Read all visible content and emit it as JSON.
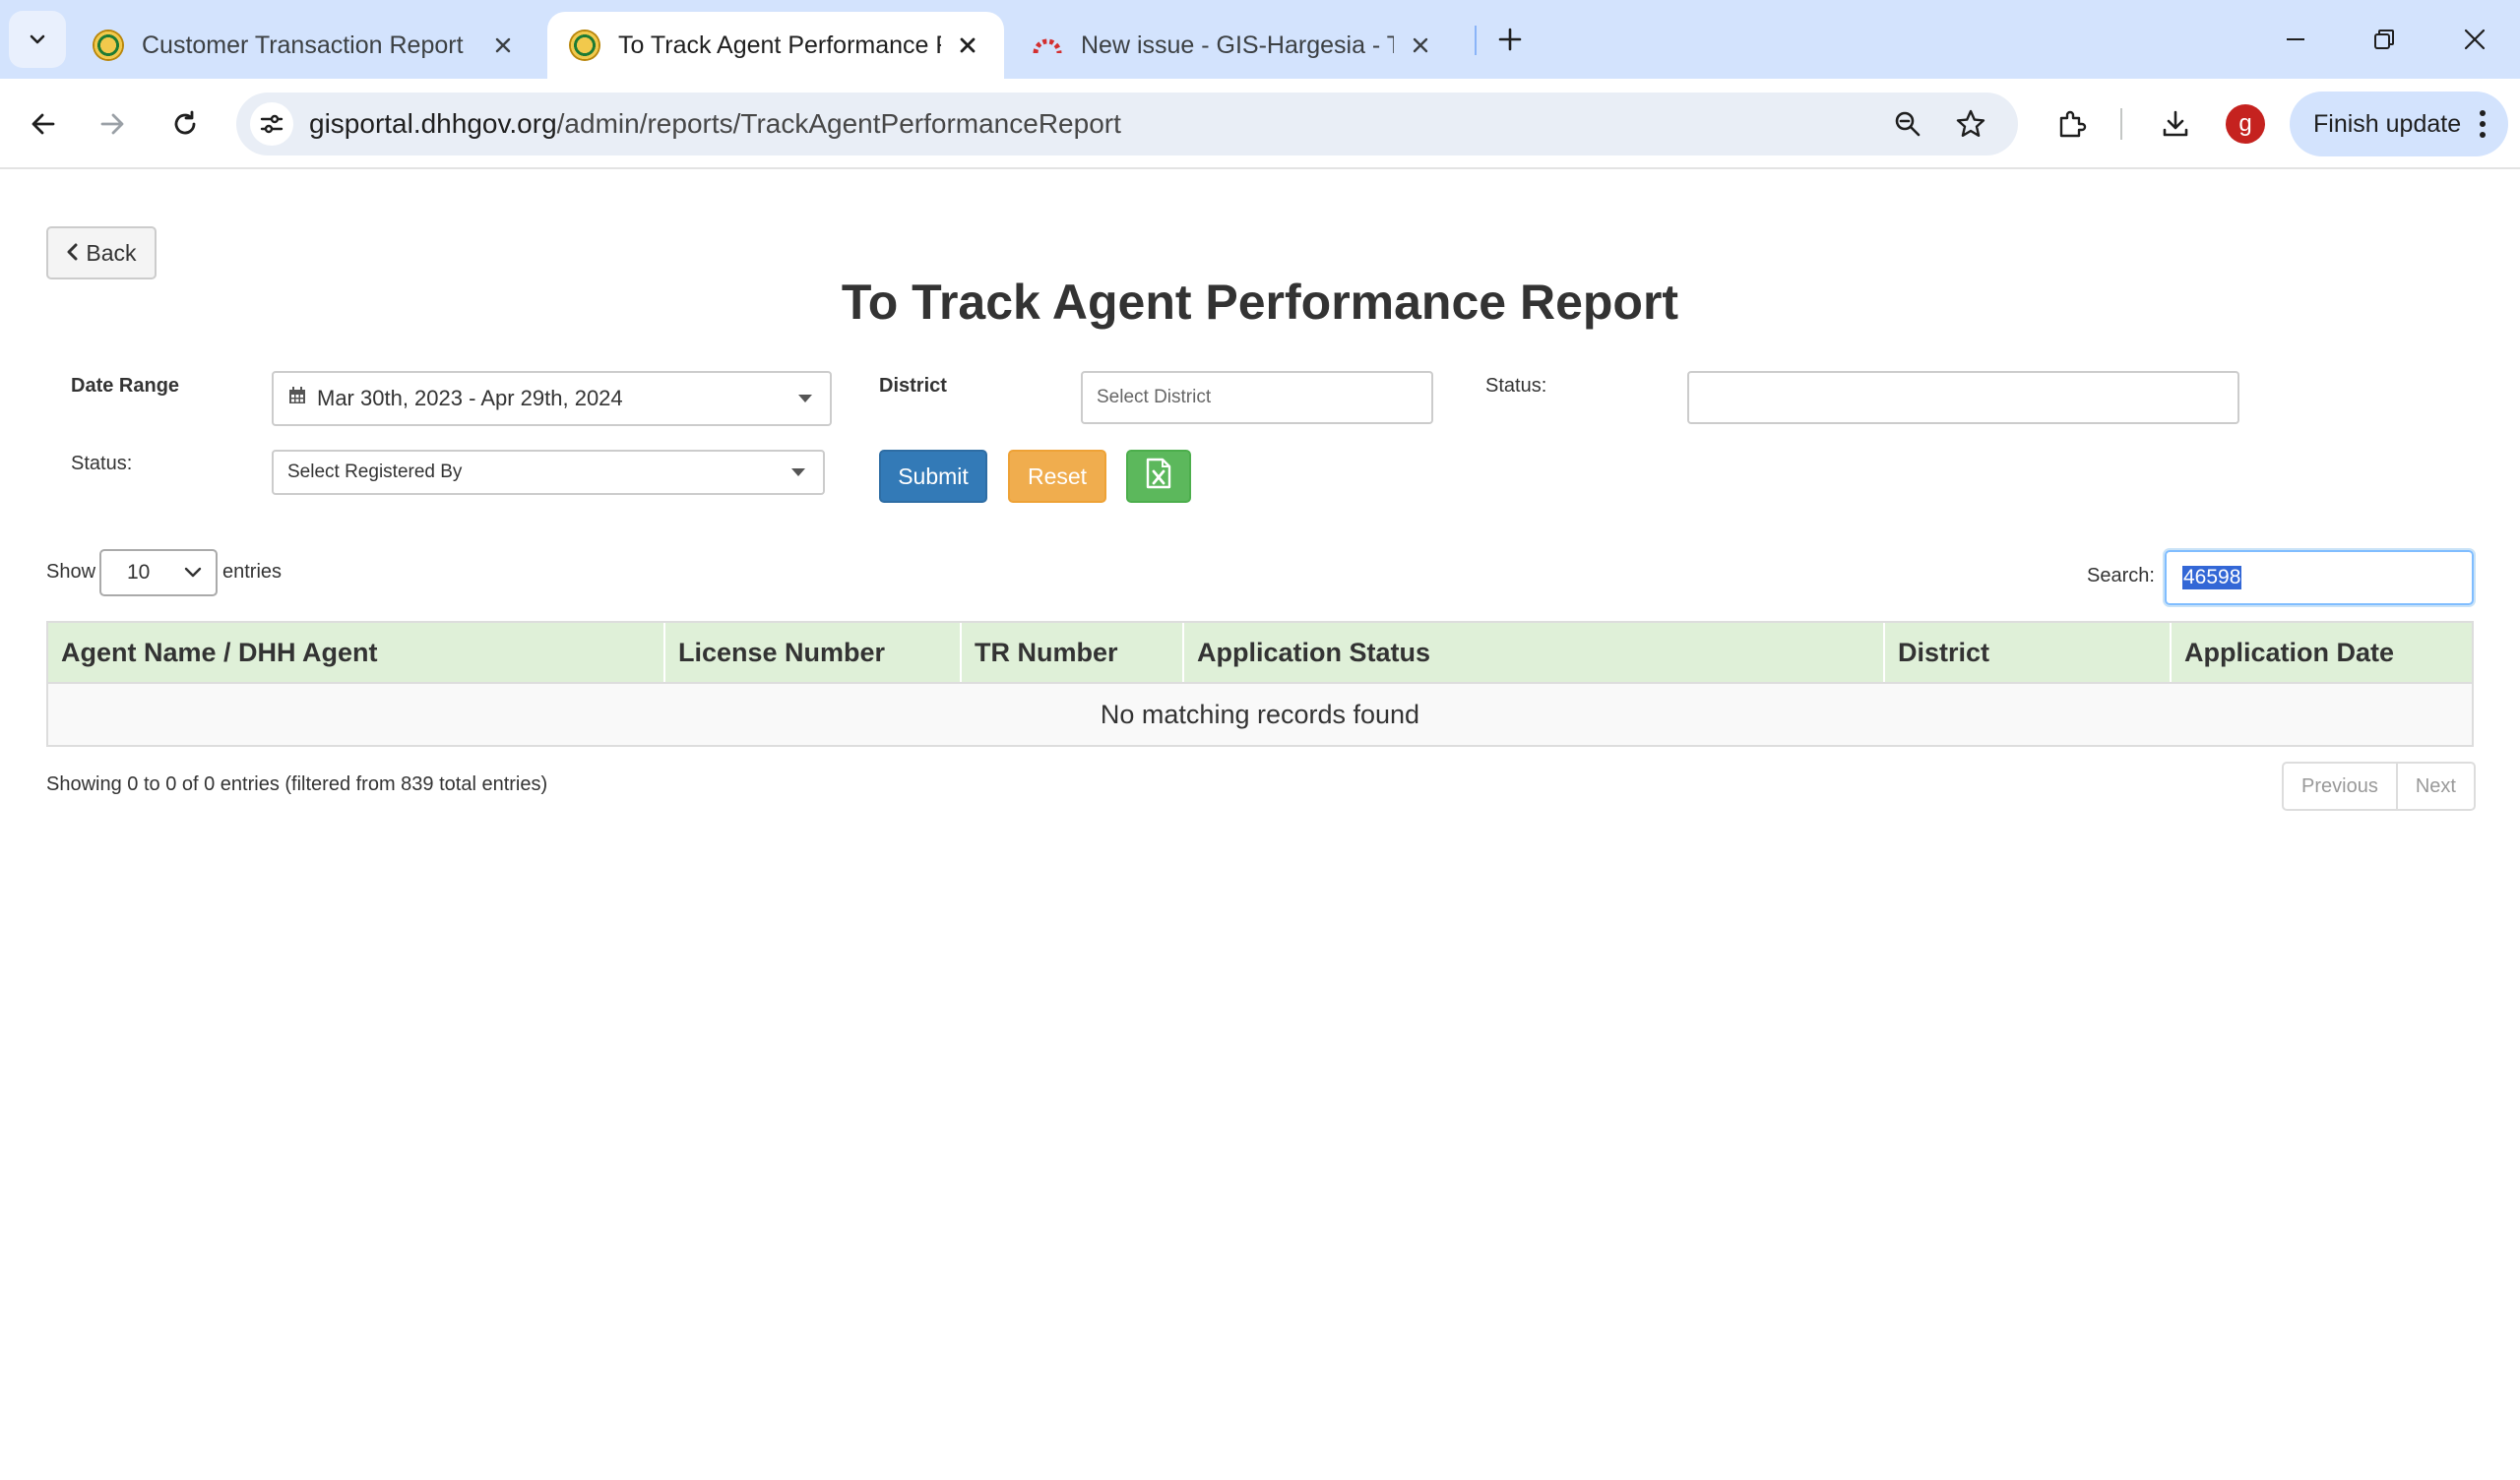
{
  "browser": {
    "tabs": [
      {
        "title": "Customer Transaction Report",
        "active": false
      },
      {
        "title": "To Track Agent Performance Re",
        "active": true
      },
      {
        "title": "New issue - GIS-Hargesia - Tear",
        "active": false
      }
    ],
    "url_host": "gisportal.dhhgov.org",
    "url_path": "/admin/reports/TrackAgentPerformanceReport",
    "profile_initial": "g",
    "finish_update_label": "Finish update"
  },
  "page": {
    "back_label": "Back",
    "title": "To Track Agent Performance Report",
    "filters": {
      "date_range_label": "Date Range",
      "date_range_value": "Mar 30th, 2023 - Apr 29th, 2024",
      "district_label": "District",
      "district_placeholder": "Select District",
      "status_label_1": "Status:",
      "status_value_1": "",
      "status_label_2": "Status:",
      "registered_by_value": "Select Registered By"
    },
    "buttons": {
      "submit": "Submit",
      "reset": "Reset"
    },
    "table_controls": {
      "show_label": "Show",
      "entries_label": "entries",
      "page_length": "10",
      "search_label": "Search:",
      "search_value": "46598"
    },
    "table": {
      "columns": [
        "Agent Name / DHH Agent",
        "License Number",
        "TR Number",
        "Application Status",
        "District",
        "Application Date"
      ],
      "empty_message": "No matching records found"
    },
    "info": "Showing 0 to 0 of 0 entries (filtered from 839 total entries)",
    "pagination": {
      "previous": "Previous",
      "next": "Next"
    }
  },
  "colors": {
    "tabstrip": "#d3e3fd",
    "table_header": "#dff0d8",
    "submit": "#337ab7",
    "reset": "#f0ad4e",
    "excel": "#5cb85c"
  },
  "icons": [
    "tab-search-icon",
    "close-icon",
    "new-tab-icon",
    "minimize-icon",
    "restore-icon",
    "back-arrow-icon",
    "forward-arrow-icon",
    "reload-icon",
    "site-info-icon",
    "zoom-icon",
    "bookmark-star-icon",
    "extensions-icon",
    "download-icon",
    "more-icon",
    "chevron-left-icon",
    "calendar-icon",
    "excel-icon"
  ]
}
